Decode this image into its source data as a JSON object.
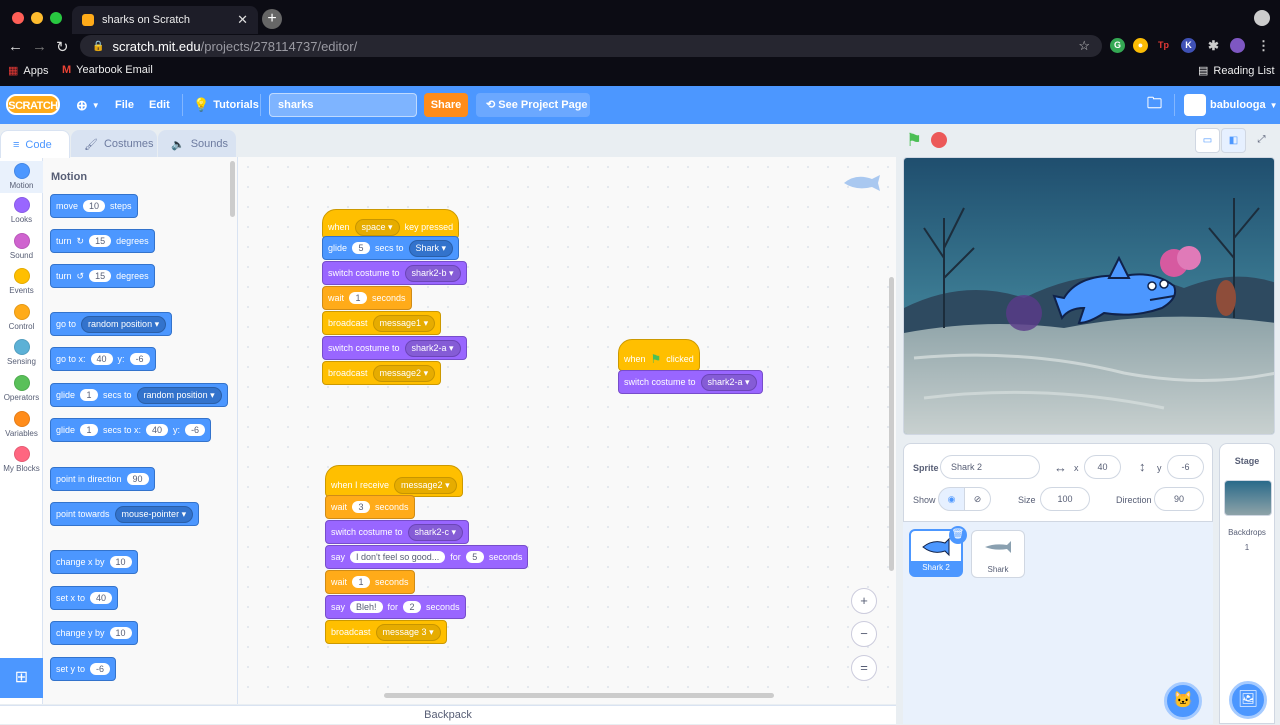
{
  "browser": {
    "tab_title": "sharks on Scratch",
    "url_host": "scratch.mit.edu",
    "url_path": "/projects/278114737/editor/",
    "bookmarks": [
      "Apps",
      "Yearbook Email"
    ],
    "reading_list": "Reading List"
  },
  "menu": {
    "logo": "SCRATCH",
    "file": "File",
    "edit": "Edit",
    "tutorials": "Tutorials",
    "project_title": "sharks",
    "share": "Share",
    "see_project_page": "See Project Page",
    "username": "babulooga",
    "accent": "#4c97ff"
  },
  "editor_tabs": [
    "Code",
    "Costumes",
    "Sounds"
  ],
  "categories": [
    {
      "label": "Motion",
      "color": "#4c97ff"
    },
    {
      "label": "Looks",
      "color": "#9966ff"
    },
    {
      "label": "Sound",
      "color": "#cf63cf"
    },
    {
      "label": "Events",
      "color": "#ffbf00"
    },
    {
      "label": "Control",
      "color": "#ffab19"
    },
    {
      "label": "Sensing",
      "color": "#5cb1d6"
    },
    {
      "label": "Operators",
      "color": "#59c059"
    },
    {
      "label": "Variables",
      "color": "#ff8c1a"
    },
    {
      "label": "My Blocks",
      "color": "#ff6680"
    }
  ],
  "palette": {
    "title": "Motion",
    "move": {
      "a": "move",
      "v": "10",
      "b": "steps"
    },
    "turn_r": {
      "a": "turn",
      "v": "15",
      "b": "degrees"
    },
    "turn_l": {
      "a": "turn",
      "v": "15",
      "b": "degrees"
    },
    "goto": {
      "a": "go to",
      "dd": "random position"
    },
    "gotoxy": {
      "a": "go to x:",
      "x": "40",
      "yl": "y:",
      "y": "-6"
    },
    "glide1": {
      "a": "glide",
      "v": "1",
      "b": "secs to",
      "dd": "random position"
    },
    "glide2": {
      "a": "glide",
      "v": "1",
      "b": "secs to x:",
      "x": "40",
      "yl": "y:",
      "y": "-6"
    },
    "point": {
      "a": "point in direction",
      "v": "90"
    },
    "towards": {
      "a": "point towards",
      "dd": "mouse-pointer"
    },
    "changex": {
      "a": "change x by",
      "v": "10"
    },
    "setx": {
      "a": "set x to",
      "v": "40"
    },
    "changey": {
      "a": "change y by",
      "v": "10"
    },
    "sety": {
      "a": "set y to",
      "v": "-6"
    }
  },
  "script1": {
    "hat": {
      "a": "when",
      "dd": "space",
      "b": "key pressed"
    },
    "glide": {
      "a": "glide",
      "v": "5",
      "b": "secs to",
      "dd": "Shark"
    },
    "costume1": {
      "a": "switch costume to",
      "dd": "shark2-b"
    },
    "wait": {
      "a": "wait",
      "v": "1",
      "b": "seconds"
    },
    "bc1": {
      "a": "broadcast",
      "dd": "message1"
    },
    "costume2": {
      "a": "switch costume to",
      "dd": "shark2-a"
    },
    "bc2": {
      "a": "broadcast",
      "dd": "message2"
    }
  },
  "script2": {
    "hat": {
      "a": "when",
      "b": "clicked"
    },
    "costume": {
      "a": "switch costume to",
      "dd": "shark2-a"
    }
  },
  "script3": {
    "hat": {
      "a": "when I receive",
      "dd": "message2"
    },
    "wait1": {
      "a": "wait",
      "v": "3",
      "b": "seconds"
    },
    "costume": {
      "a": "switch costume to",
      "dd": "shark2-c"
    },
    "say1": {
      "a": "say",
      "v": "I don't feel so good...",
      "b": "for",
      "v2": "5",
      "c": "seconds"
    },
    "wait2": {
      "a": "wait",
      "v": "1",
      "b": "seconds"
    },
    "say2": {
      "a": "say",
      "v": "Bleh!",
      "b": "for",
      "v2": "2",
      "c": "seconds"
    },
    "bc": {
      "a": "broadcast",
      "dd": "message 3"
    }
  },
  "zoom": {
    "in": "+",
    "out": "−",
    "reset": "="
  },
  "backpack": "Backpack",
  "sprite_info": {
    "sprite_label": "Sprite",
    "sprite_name": "Shark 2",
    "x_label": "x",
    "x": "40",
    "y_label": "y",
    "y": "-6",
    "show_label": "Show",
    "size_label": "Size",
    "size": "100",
    "direction_label": "Direction",
    "direction": "90"
  },
  "sprites": [
    "Shark 2",
    "Shark"
  ],
  "stage_panel": {
    "title": "Stage",
    "backdrops_label": "Backdrops",
    "backdrops_count": "1"
  }
}
